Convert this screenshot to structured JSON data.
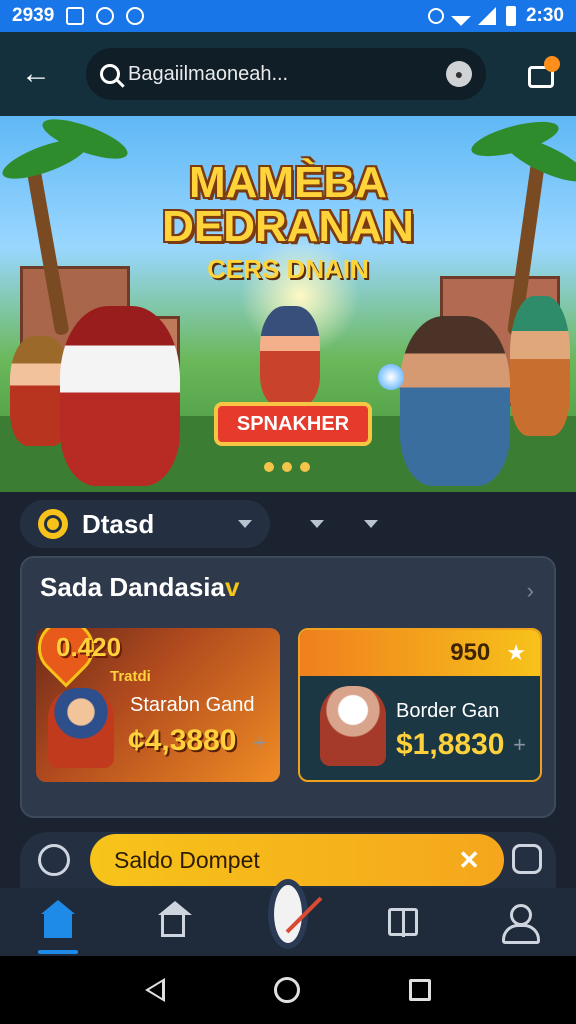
{
  "status_bar": {
    "time_left": "2939",
    "time_right": "2:30"
  },
  "header": {
    "search_text": "Bagaiilmaoneah..."
  },
  "banner": {
    "title_line1": "MAMÈBA",
    "title_line2": "DEDRANAN",
    "subtitle": "CERS DNAIN",
    "cta_label": "SPNAKHER"
  },
  "tabs": {
    "active_label": "Dtasd"
  },
  "section": {
    "heading": "Sada Dandasia",
    "heading_accent": "v"
  },
  "products": [
    {
      "badge_value": "0.420",
      "badge_label": "Tratdi",
      "name": "Starabn Gand",
      "price": "¢4,3880",
      "action": "+"
    },
    {
      "header_value": "950",
      "name": "Border Gan",
      "price": "$1,8830",
      "action": "+"
    }
  ],
  "wallet": {
    "label": "Saldo Dompet",
    "close": "✕"
  },
  "colors": {
    "accent": "#f7c21a",
    "primary_blue": "#1976e8",
    "background": "#1b2331"
  }
}
